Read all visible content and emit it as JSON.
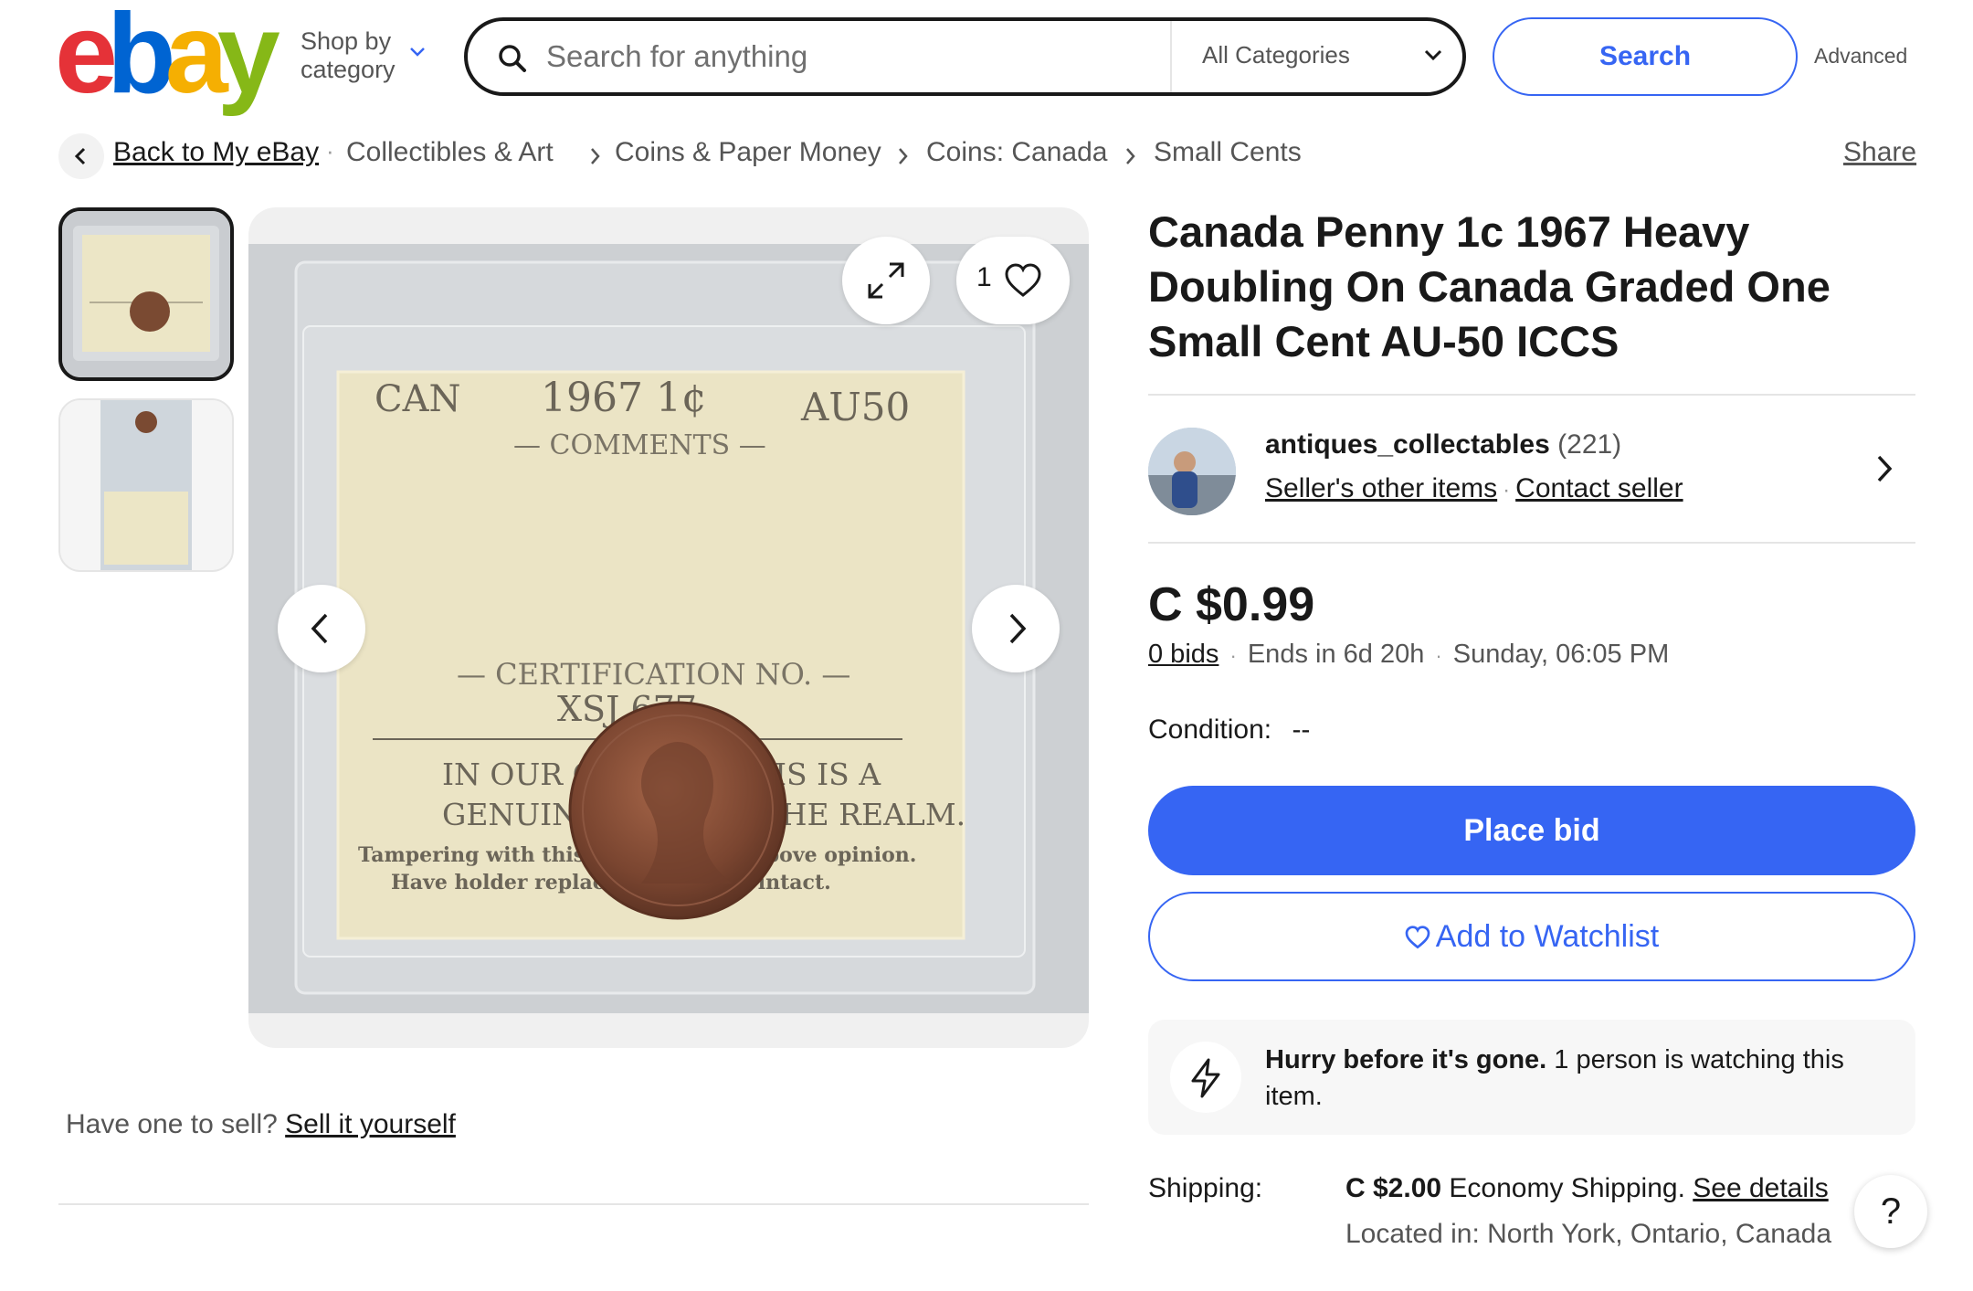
{
  "header": {
    "logo_letters": [
      "e",
      "b",
      "a",
      "y"
    ],
    "logo_colors": [
      "#e53238",
      "#0064d2",
      "#f5af02",
      "#86b817"
    ],
    "shop_by_line1": "Shop by",
    "shop_by_line2": "category",
    "search_placeholder": "Search for anything",
    "category_selected": "All Categories",
    "search_button": "Search",
    "advanced": "Advanced"
  },
  "breadcrumb": {
    "back": "Back to My eBay",
    "items": [
      "Collectibles & Art",
      "Coins & Paper Money",
      "Coins: Canada",
      "Small Cents"
    ],
    "share": "Share"
  },
  "gallery": {
    "favorite_count": "1",
    "sell_prompt": "Have one to sell?",
    "sell_link": "Sell it yourself",
    "holder_text": {
      "country": "CAN",
      "year_denom": "1967 1¢",
      "grade": "AU50",
      "comments": "— COMMENTS —",
      "cert_label": "— CERTIFICATION NO. —",
      "cert_no": "XSJ 677",
      "opinion_1": "IN OUR OPINION THIS IS A",
      "opinion_2": "GENUINE COIN OF THE REALM.",
      "tamper_1": "Tampering with this seal voids the above opinion.",
      "tamper_2": "Have holder replaced if seal not intact."
    }
  },
  "listing": {
    "title": "Canada Penny 1c 1967 Heavy Doubling On Canada Graded One Small Cent AU-50 ICCS",
    "seller_name": "antiques_collectables",
    "seller_feedback": "(221)",
    "seller_other_items": "Seller's other items",
    "contact_seller": "Contact seller",
    "price": "C $0.99",
    "bids": "0 bids",
    "ends_in": "Ends in 6d 20h",
    "end_time": "Sunday, 06:05 PM",
    "condition_label": "Condition:",
    "condition_value": "--",
    "place_bid": "Place bid",
    "add_watchlist": "Add to Watchlist",
    "hurry_bold": "Hurry before it's gone.",
    "hurry_rest": "1 person is watching this item.",
    "shipping_label": "Shipping:",
    "shipping_price": "C $2.00",
    "shipping_method": "Economy Shipping.",
    "see_details": "See details",
    "located_in": "Located in: North York, Ontario, Canada"
  },
  "help": "?",
  "colors": {
    "accent": "#3665f3",
    "text": "#191919",
    "muted": "#555555"
  }
}
